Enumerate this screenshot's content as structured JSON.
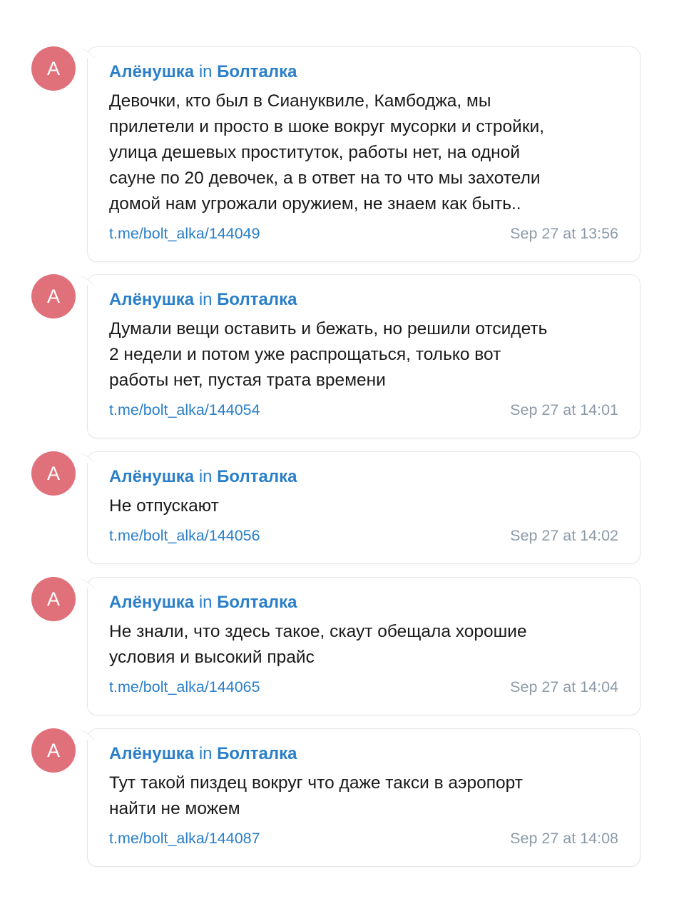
{
  "theme": {
    "avatar_color": "#e0707a",
    "link_color": "#2a7fc8",
    "date_color": "#8c9aa8",
    "border_color": "#e3e7eb"
  },
  "messages": [
    {
      "avatar_letter": "А",
      "author": "Алёнушка",
      "in_word": "in",
      "chat": "Болталка",
      "text": "Девочки, кто был в Сиануквиле, Камбоджа, мы\nприлетели и просто в шоке вокруг мусорки и стройки,\nулица дешевых проституток, работы нет, на одной\nсауне по 20 девочек, а в ответ на то что мы захотели\nдомой нам угрожали оружием, не знаем как быть..",
      "link": "t.me/bolt_alka/144049",
      "date": "Sep 27 at 13:56"
    },
    {
      "avatar_letter": "А",
      "author": "Алёнушка",
      "in_word": "in",
      "chat": "Болталка",
      "text": "Думали вещи оставить и бежать, но решили отсидеть\n2 недели и потом уже распрощаться, только вот\nработы нет, пустая трата времени",
      "link": "t.me/bolt_alka/144054",
      "date": "Sep 27 at 14:01"
    },
    {
      "avatar_letter": "А",
      "author": "Алёнушка",
      "in_word": "in",
      "chat": "Болталка",
      "text": "Не отпускают",
      "link": "t.me/bolt_alka/144056",
      "date": "Sep 27 at 14:02"
    },
    {
      "avatar_letter": "А",
      "author": "Алёнушка",
      "in_word": "in",
      "chat": "Болталка",
      "text": "Не знали, что здесь такое, скаут обещала хорошие\nусловия и высокий прайс",
      "link": "t.me/bolt_alka/144065",
      "date": "Sep 27 at 14:04"
    },
    {
      "avatar_letter": "А",
      "author": "Алёнушка",
      "in_word": "in",
      "chat": "Болталка",
      "text": "Тут такой пиздец вокруг что даже такси в аэропорт\nнайти не можем",
      "link": "t.me/bolt_alka/144087",
      "date": "Sep 27 at 14:08"
    }
  ]
}
